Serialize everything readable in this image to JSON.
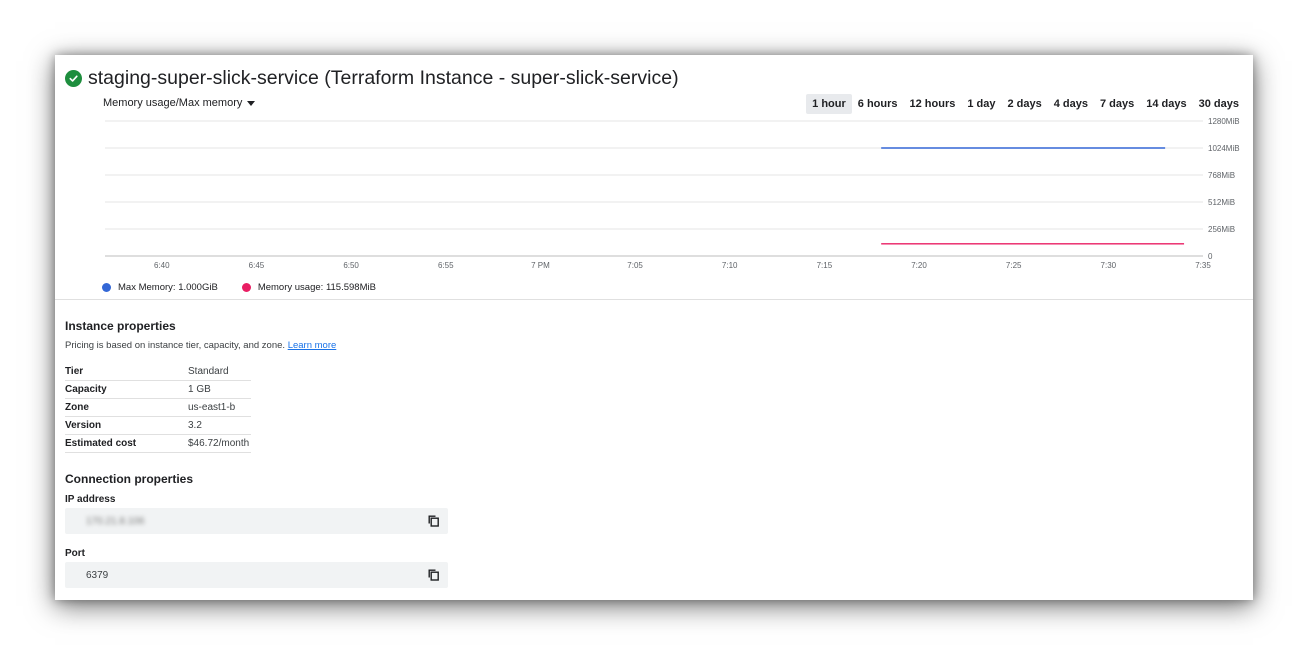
{
  "header": {
    "title": "staging-super-slick-service (Terraform Instance - super-slick-service)",
    "status_icon": "check-circle-icon",
    "status_color": "#1e8e3e"
  },
  "metric_selector": {
    "label": "Memory usage/Max memory"
  },
  "time_ranges": [
    {
      "label": "1 hour",
      "active": true
    },
    {
      "label": "6 hours",
      "active": false
    },
    {
      "label": "12 hours",
      "active": false
    },
    {
      "label": "1 day",
      "active": false
    },
    {
      "label": "2 days",
      "active": false
    },
    {
      "label": "4 days",
      "active": false
    },
    {
      "label": "7 days",
      "active": false
    },
    {
      "label": "14 days",
      "active": false
    },
    {
      "label": "30 days",
      "active": false
    }
  ],
  "chart_data": {
    "type": "line",
    "x_ticks": [
      "6:40",
      "6:45",
      "6:50",
      "6:55",
      "7 PM",
      "7:05",
      "7:10",
      "7:15",
      "7:20",
      "7:25",
      "7:30",
      "7:35"
    ],
    "y_ticks": [
      "0",
      "256MiB",
      "512MiB",
      "768MiB",
      "1024MiB",
      "1280MiB"
    ],
    "ylim": [
      0,
      1280
    ],
    "xlim_minutes": [
      "6:37",
      "7:35"
    ],
    "grid": true,
    "legend_position": "bottom-left",
    "series": [
      {
        "name": "Max Memory",
        "value_label": "1.000GiB",
        "color": "#3367d6",
        "x_start": "7:18",
        "x_end": "7:33",
        "value": 1024
      },
      {
        "name": "Memory usage",
        "value_label": "115.598MiB",
        "color": "#e91e63",
        "x_start": "7:18",
        "x_end": "7:34",
        "value": 115.6
      }
    ]
  },
  "instance_properties": {
    "title": "Instance properties",
    "description": "Pricing is based on instance tier, capacity, and zone.",
    "learn_more": "Learn more",
    "rows": [
      {
        "key": "Tier",
        "value": "Standard"
      },
      {
        "key": "Capacity",
        "value": "1 GB"
      },
      {
        "key": "Zone",
        "value": "us-east1-b"
      },
      {
        "key": "Version",
        "value": "3.2"
      },
      {
        "key": "Estimated cost",
        "value": "$46.72/month"
      }
    ]
  },
  "connection_properties": {
    "title": "Connection properties",
    "ip_label": "IP address",
    "ip_value": "170.21.8.106",
    "port_label": "Port",
    "port_value": "6379",
    "copy_icon": "copy-icon"
  }
}
